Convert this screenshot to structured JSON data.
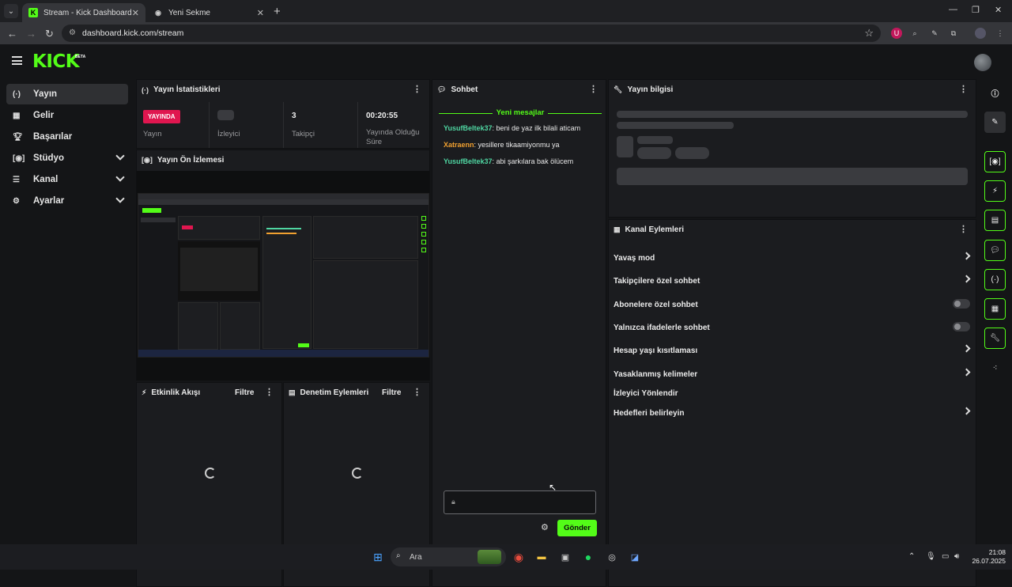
{
  "browser": {
    "tabs": [
      {
        "title": "Stream - Kick Dashboard",
        "active": true
      },
      {
        "title": "Yeni Sekme",
        "active": false
      }
    ],
    "url": "dashboard.kick.com/stream"
  },
  "app": {
    "logo": "KICK",
    "logo_badge": "BETA",
    "sidebar": [
      {
        "label": "Yayın",
        "active": true,
        "expandable": false
      },
      {
        "label": "Gelir",
        "active": false,
        "expandable": false
      },
      {
        "label": "Başarılar",
        "active": false,
        "expandable": false
      },
      {
        "label": "Stüdyo",
        "active": false,
        "expandable": true
      },
      {
        "label": "Kanal",
        "active": false,
        "expandable": true
      },
      {
        "label": "Ayarlar",
        "active": false,
        "expandable": true
      }
    ],
    "stats": {
      "title": "Yayın İstatistikleri",
      "status_badge": "YAYINDA",
      "status_label": "Yayın",
      "viewers_label": "İzleyici",
      "followers_value": "3",
      "followers_label": "Takipçi",
      "uptime_value": "00:20:55",
      "uptime_label_1": "Yayında Olduğu",
      "uptime_label_2": "Süre"
    },
    "preview": {
      "title": "Yayın Ön İzlemesi"
    },
    "activity": {
      "title": "Etkinlik Akışı",
      "filter": "Filtre"
    },
    "moderation": {
      "title": "Denetim Eylemleri",
      "filter": "Filtre"
    },
    "chat": {
      "title": "Sohbet",
      "new_messages": "Yeni mesajlar",
      "messages": [
        {
          "user": "YusufBeltek37",
          "text": ": beni de yaz ilk bilali aticam",
          "color": "#4fd6a2"
        },
        {
          "user": "Xatraenn",
          "text": ": yesillere tikaamiyonmu ya",
          "color": "#f0a030"
        },
        {
          "user": "YusufBeltek37",
          "text": ": abi şarkılara bak ölücem",
          "color": "#4fd6a2"
        }
      ],
      "send_button": "Gönder"
    },
    "stream_info": {
      "title": "Yayın bilgisi"
    },
    "channel_actions": {
      "title": "Kanal Eylemleri",
      "items": [
        {
          "label": "Yavaş mod",
          "control": "arrow"
        },
        {
          "label": "Takipçilere özel sohbet",
          "control": "arrow"
        },
        {
          "label": "Abonelere özel sohbet",
          "control": "toggle",
          "on": false
        },
        {
          "label": "Yalnızca ifadelerle sohbet",
          "control": "toggle",
          "on": false
        },
        {
          "label": "Hesap yaşı kısıtlaması",
          "control": "arrow"
        },
        {
          "label": "Yasaklanmış kelimeler",
          "control": "arrow"
        },
        {
          "label": "İzleyici Yönlendir",
          "control": "none"
        },
        {
          "label": "Hedefleri belirleyin",
          "control": "arrow"
        }
      ]
    }
  },
  "taskbar": {
    "search_placeholder": "Ara",
    "time": "21:08",
    "date": "26.07.2025"
  },
  "colors": {
    "accent": "#53fc18",
    "live": "#e0164f"
  }
}
